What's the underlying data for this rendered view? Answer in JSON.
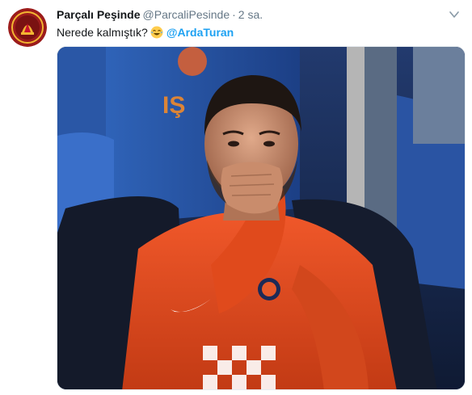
{
  "tweet": {
    "display_name": "Parçalı Peşinde",
    "handle": "@ParcaliPesinde",
    "separator": "·",
    "time": "2 sa.",
    "text": "Nerede kalmıştık?",
    "emoji": "face-with-tears-of-joy-emoji",
    "mention": "@ArdaTuran"
  },
  "icons": {
    "caret": "chevron-down-icon",
    "avatar_logo": "club-crest-icon"
  },
  "colors": {
    "link": "#1da1f2",
    "name": "#14171a",
    "meta": "#657786",
    "avatar_bg": "#8b1a1a",
    "avatar_gold": "#f2b632"
  }
}
